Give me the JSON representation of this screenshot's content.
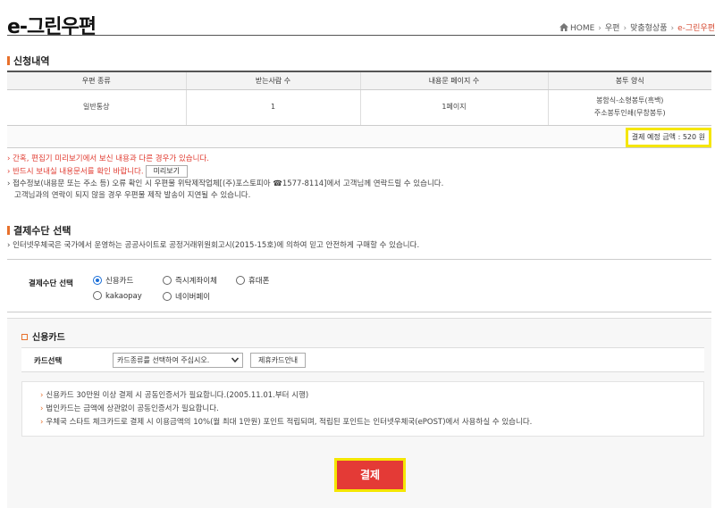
{
  "header": {
    "title": "e-그린우편",
    "breadcrumb": [
      "HOME",
      "우편",
      "맞춤형상품",
      "e-그린우편"
    ]
  },
  "apply_section": {
    "title": "신청내역",
    "columns": [
      "우편 종류",
      "받는사람 수",
      "내용문 페이지 수",
      "봉투 양식"
    ],
    "row": {
      "mail_type": "일반통상",
      "recipients": "1",
      "pages": "1페이지",
      "envelope_line1": "봉함식-소형봉투(흑백)",
      "envelope_line2": "주소봉투인쇄(무창봉투)"
    },
    "total_label": "결제 예정 금액 : 520 원"
  },
  "notes": {
    "n1": "› 간혹, 편집기 미리보기에서 보신 내용과 다른 경우가 있습니다.",
    "n2": "› 반드시 보내실 내용문서를 확인 바랍니다.",
    "preview_button": "미리보기",
    "n3": "› 접수정보(내용문 또는 주소 등) 오류 확인 시 우편물 위탁제작업체[(주)포스토피아 ☎1577-8114]에서 고객님께 연락드릴 수 있습니다.",
    "n4": "고객님과의 연락이 되지 않을 경우 우편물 제작 발송이 지연될 수 있습니다."
  },
  "payment_section": {
    "title": "결제수단 선택",
    "description": "› 인터넷우체국은 국가에서 운영하는 공공사이트로 공정거래위원회고시(2015-15호)에 의하여 믿고 안전하게 구매할 수 있습니다.",
    "method_label": "결제수단 선택",
    "methods": [
      "신용카드",
      "즉시계좌이체",
      "휴대폰",
      "kakaopay",
      "네이버페이"
    ],
    "selected_method": "신용카드"
  },
  "card_section": {
    "title": "신용카드",
    "select_label": "카드선택",
    "select_value": "카드종류를 선택하여 주십시오.",
    "partner_button": "제휴카드안내",
    "info": [
      "신용카드 30만원 이상 결제 시 공동인증서가 필요합니다.(2005.11.01.부터 시행)",
      "법인카드는 금액에 상관없이 공동인증서가 필요합니다.",
      "우체국 스타트 체크카드로 결제 시 이용금액의 10%(월 최대 1만원) 포인트 적립되며, 적립된 포인트는 인터넷우체국(ePOST)에서 사용하실 수 있습니다."
    ],
    "pay_button": "결제"
  },
  "colors": {
    "accent_orange": "#e8712c",
    "alert_red": "#e03a2f",
    "pay_button": "#e43a36",
    "highlight_yellow": "#f5e600",
    "radio_blue": "#1a6ed8"
  }
}
